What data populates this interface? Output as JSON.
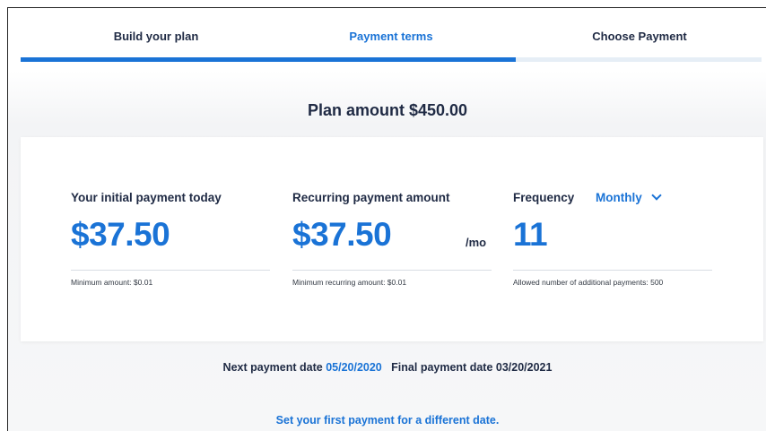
{
  "steps": [
    {
      "label": "Build your plan"
    },
    {
      "label": "Payment terms"
    },
    {
      "label": "Choose Payment"
    }
  ],
  "plan": {
    "label": "Plan amount",
    "amount": "$450.00"
  },
  "initial": {
    "title": "Your initial payment today",
    "amount": "$37.50",
    "hint": "Minimum amount: $0.01"
  },
  "recurring": {
    "title": "Recurring payment amount",
    "amount": "$37.50",
    "unit": "/mo",
    "hint": "Minimum recurring amount: $0.01"
  },
  "frequency": {
    "title": "Frequency",
    "selected": "Monthly",
    "count": "11",
    "hint": "Allowed number of additional payments: 500"
  },
  "dates": {
    "next_label": "Next payment date",
    "next_value": "05/20/2020",
    "final_label": "Final payment date",
    "final_value": "03/20/2021"
  },
  "link": "Set your first payment for a different date.",
  "colors": {
    "accent": "#1a73d6",
    "text": "#1f2a44"
  },
  "progress": {
    "active_step": 2,
    "total_steps": 3
  }
}
